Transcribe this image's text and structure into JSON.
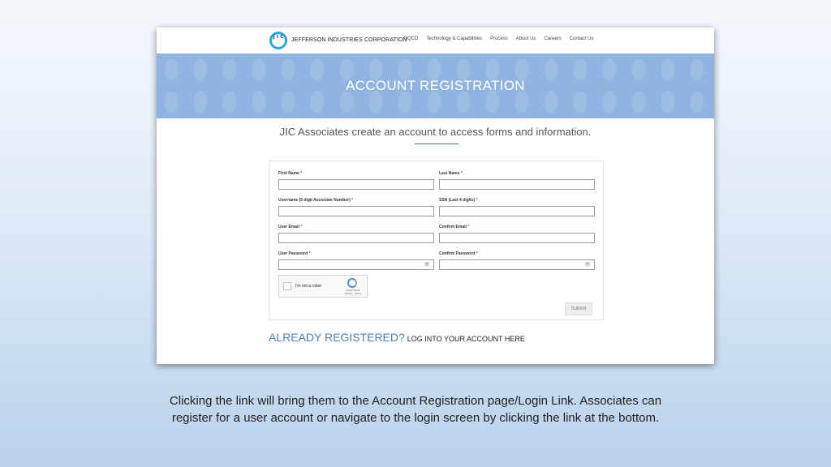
{
  "site": {
    "logo_text": "J I C",
    "company": "JEFFERSON INDUSTRIES CORPORATION",
    "nav": [
      "SQCD",
      "Technology & Capabilities",
      "Process",
      "About Us",
      "Careers",
      "Contact Us"
    ]
  },
  "hero": {
    "title": "ACCOUNT REGISTRATION"
  },
  "intro": "JIC Associates create an account to access forms and information.",
  "form": {
    "first_name_label": "First Name",
    "last_name_label": "Last Name",
    "username_label": "Username (5 digit Associate Number)",
    "ssn_label": "SSN (Last 4 digits)",
    "email_label": "User Email",
    "confirm_email_label": "Confirm Email",
    "password_label": "User Password",
    "confirm_password_label": "Confirm Password",
    "required_mark": "*",
    "captcha_label": "I'm not a robot",
    "captcha_brand": "reCAPTCHA",
    "captcha_links": "Privacy - Terms",
    "submit_label": "Submit"
  },
  "login": {
    "already": "ALREADY REGISTERED?",
    "link": "LOG INTO YOUR ACCOUNT HERE"
  },
  "caption": {
    "line1": "Clicking the link will bring them to the Account Registration page/Login Link.  Associates can",
    "line2": "register for a user account or navigate to the login screen by clicking the link at the bottom."
  },
  "colors": {
    "hero": "#8fb4df",
    "accent": "#4d7fbf",
    "logo": "#29a8df"
  }
}
